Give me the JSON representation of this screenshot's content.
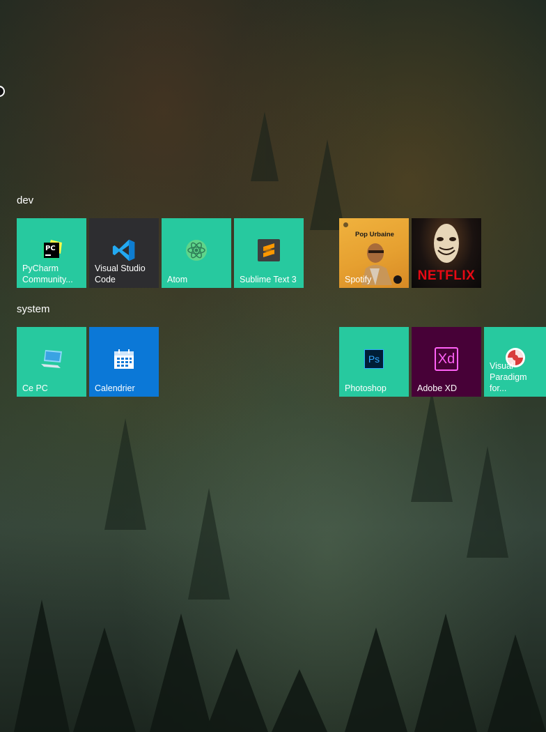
{
  "groups": {
    "dev": {
      "label": "dev"
    },
    "system": {
      "label": "system"
    }
  },
  "tiles": {
    "pycharm": {
      "label": "PyCharm\nCommunity...",
      "icon": "pycharm-icon"
    },
    "vscode": {
      "label": "Visual Studio\nCode",
      "icon": "vscode-icon"
    },
    "atom": {
      "label": "Atom",
      "icon": "atom-icon"
    },
    "sublime": {
      "label": "Sublime Text 3",
      "icon": "sublime-icon"
    },
    "spotify": {
      "label": "Spotify",
      "playlist": "Pop Urbaine",
      "icon": "spotify-icon"
    },
    "netflix": {
      "label": "NETFLIX",
      "icon": "netflix-logo"
    },
    "thispc": {
      "label": "Ce PC",
      "icon": "computer-icon"
    },
    "calendar": {
      "label": "Calendrier",
      "icon": "calendar-icon"
    },
    "photoshop": {
      "label": "Photoshop",
      "icon_text": "Ps"
    },
    "xd": {
      "label": "Adobe XD",
      "icon_text": "Xd"
    },
    "paradigm": {
      "label": "Visual\nParadigm for...",
      "icon": "visual-paradigm-icon"
    }
  },
  "colors": {
    "tile_teal": "#27c99f",
    "tile_dark": "#2d2d30",
    "calendar_blue": "#0b78d7",
    "xd_purple": "#470137",
    "xd_pink": "#ff61f6",
    "ps_blue": "#31a8ff",
    "netflix_red": "#e50914"
  }
}
